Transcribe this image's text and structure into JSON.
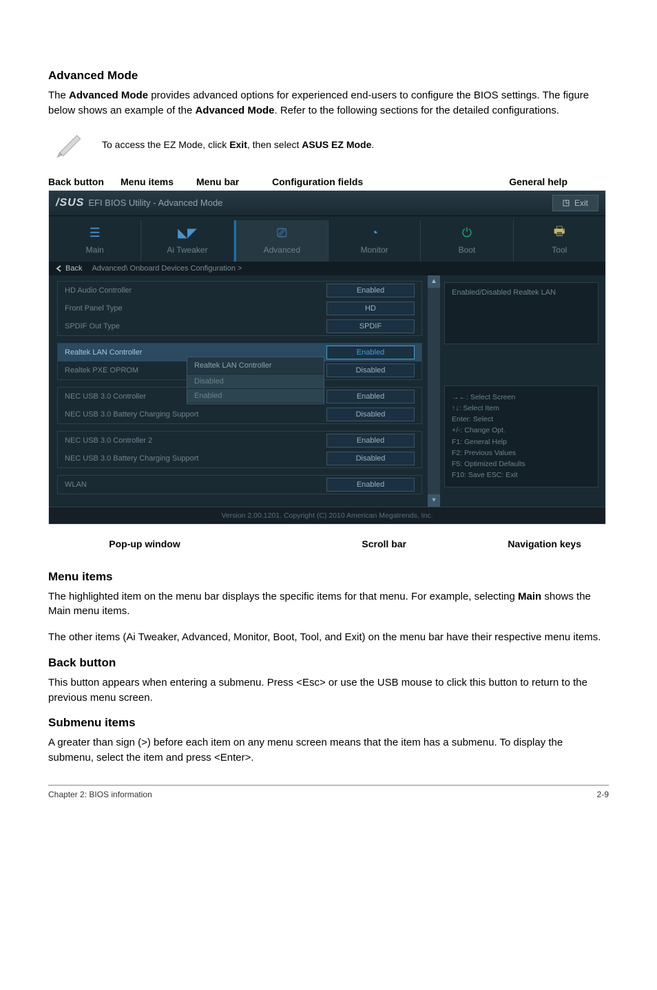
{
  "page": {
    "sec1_title": "Advanced Mode",
    "sec1_body_prefix": "The ",
    "sec1_body_strong1": "Advanced Mode",
    "sec1_body_mid": " provides advanced options for experienced end-users to configure the BIOS settings. The figure below shows an example of the ",
    "sec1_body_strong2": "Advanced Mode",
    "sec1_body_suffix": ". Refer to the following sections for the detailed configurations.",
    "tip_prefix": "To access the EZ Mode, click ",
    "tip_strong1": "Exit",
    "tip_mid": ", then select ",
    "tip_strong2": "ASUS EZ Mode",
    "tip_suffix": ".",
    "sec2_title": "Menu items",
    "sec2_p1_prefix": "The highlighted item on the menu bar displays the specific items for that menu. For example, selecting ",
    "sec2_p1_strong": "Main",
    "sec2_p1_suffix": " shows the Main menu items.",
    "sec2_p2": "The other items (Ai Tweaker, Advanced, Monitor, Boot, Tool, and Exit) on the menu bar have their respective menu items.",
    "sec3_title": "Back button",
    "sec3_body": "This button appears when entering a submenu. Press <Esc> or use the USB mouse to click this button to return to the previous menu screen.",
    "sec4_title": "Submenu items",
    "sec4_body": "A greater than sign (>) before each item on any menu screen means that the item has a submenu. To display the submenu, select the item and press <Enter>.",
    "footer_left": "Chapter 2: BIOS information",
    "footer_right": "2-9"
  },
  "labels": {
    "back_button": "Back button",
    "menu_items": "Menu items",
    "menu_bar": "Menu bar",
    "config_fields": "Configuration fields",
    "general_help": "General help",
    "popup": "Pop-up window",
    "scrollbar": "Scroll bar",
    "navkeys": "Navigation keys"
  },
  "bios": {
    "logo": "/SUS",
    "title": "EFI BIOS Utility - Advanced Mode",
    "exit": "Exit",
    "tabs": [
      {
        "label": "Main"
      },
      {
        "label": "Ai Tweaker"
      },
      {
        "label": "Advanced"
      },
      {
        "label": "Monitor"
      },
      {
        "label": "Boot"
      },
      {
        "label": "Tool"
      }
    ],
    "back": "Back",
    "breadcrumb": "Advanced\\ Onboard Devices Configuration >",
    "sections": [
      {
        "rows": [
          {
            "label": "HD Audio Controller",
            "value": "Enabled"
          },
          {
            "label": "Front Panel Type",
            "value": "HD"
          },
          {
            "label": "SPDIF Out Type",
            "value": "SPDIF"
          }
        ]
      },
      {
        "rows": [
          {
            "label": "Realtek LAN Controller",
            "value": "Enabled",
            "active": true
          },
          {
            "label": "Realtek PXE OPROM",
            "value": "Disabled"
          }
        ]
      },
      {
        "rows": [
          {
            "label": "NEC USB 3.0 Controller",
            "value": "Enabled"
          },
          {
            "label": "NEC USB 3.0 Battery Charging Support",
            "value": "Disabled"
          }
        ]
      },
      {
        "rows": [
          {
            "label": "NEC USB 3.0 Controller 2",
            "value": "Enabled"
          },
          {
            "label": "NEC USB 3.0 Battery Charging Support",
            "value": "Disabled"
          }
        ]
      },
      {
        "rows": [
          {
            "label": "WLAN",
            "value": "Enabled"
          }
        ]
      }
    ],
    "popup": {
      "title": "Realtek LAN Controller",
      "items": [
        "Disabled",
        "Enabled"
      ]
    },
    "help_text": "Enabled/Disabled Realtek LAN",
    "nav_lines": [
      "→←: Select Screen",
      "↑↓: Select Item",
      "Enter: Select",
      "+/-: Change Opt.",
      "F1: General Help",
      "F2: Previous Values",
      "F5: Optimized Defaults",
      "F10: Save   ESC: Exit"
    ],
    "footer": "Version 2.00.1201. Copyright (C) 2010 American Megatrends, Inc."
  }
}
